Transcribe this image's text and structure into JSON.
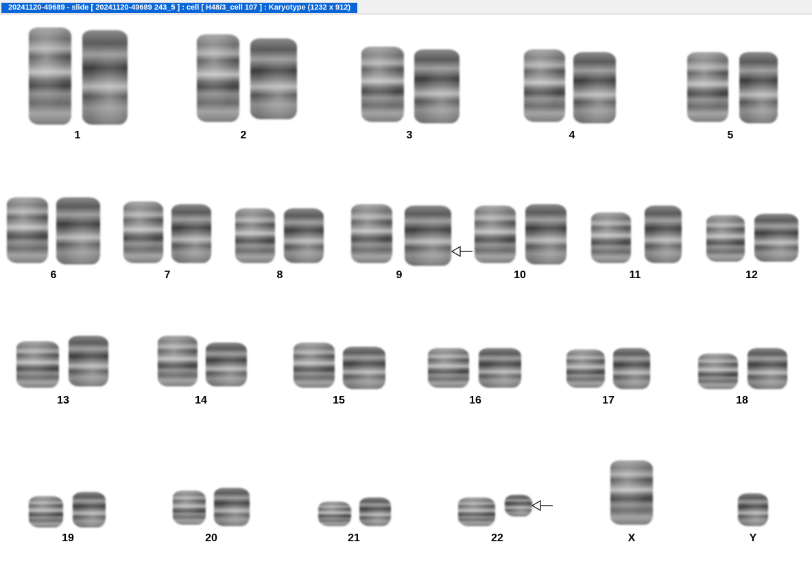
{
  "window": {
    "title": "20241120-49689 - slide [ 20241120-49689 243_5 ] : cell [ H48/3_cell 107 ] : Karyotype  (1232 x 912)"
  },
  "karyotype": {
    "labels": [
      "1",
      "2",
      "3",
      "4",
      "5",
      "6",
      "7",
      "8",
      "9",
      "10",
      "11",
      "12",
      "13",
      "14",
      "15",
      "16",
      "17",
      "18",
      "19",
      "20",
      "21",
      "22",
      "X",
      "Y"
    ],
    "marked": [
      "9",
      "22"
    ],
    "marker_icon": "hollow-left-arrow"
  }
}
